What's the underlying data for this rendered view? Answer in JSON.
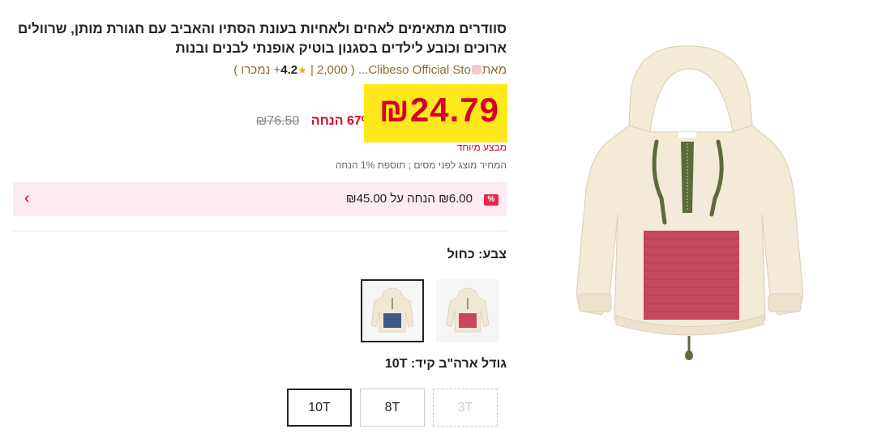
{
  "product": {
    "title": "סוודרים מתאימים לאחים ולאחיות בעונת הסתיו והאביב עם חגורת מותן, שרוולים ארוכים וכובע לילדים בסגנון בוטיק אופנתי לבנים ובנות",
    "by_label": "מאת",
    "store_name": "Clibeso Official Sto...",
    "rating": "4.2",
    "sold_count": "2,000+",
    "sold_label": "נמכרו",
    "open_paren": "(",
    "close_paren": ")",
    "separator": "|"
  },
  "pricing": {
    "current_price": "₪24.79",
    "discount_percent": "67%",
    "discount_word": "הנחה",
    "original_price": "₪76.50",
    "special_offer": "מבצע מיוחד",
    "tax_note": "המחיר מוצג לפני מסים ; תוספת 1% הנחה"
  },
  "coupon": {
    "badge": "%",
    "text": "₪6.00 הנחה על ₪45.00",
    "arrow": "›"
  },
  "color": {
    "label": "צבע: כחול",
    "options": [
      {
        "name": "blue",
        "selected": true,
        "pocket_color": "#3e5a8a"
      },
      {
        "name": "red",
        "selected": false,
        "pocket_color": "#c5485e"
      }
    ]
  },
  "size": {
    "label": "גודל ארה\"ב קיד: 10T",
    "options": [
      {
        "label": "10T",
        "state": "selected"
      },
      {
        "label": "8T",
        "state": "available"
      },
      {
        "label": "3T",
        "state": "disabled"
      }
    ]
  },
  "colors": {
    "accent_red": "#d4002a",
    "price_highlight": "#ffe81a",
    "coupon_bg": "#fdecef",
    "hoodie_cream": "#f3ead7",
    "pocket_red": "#c5485e"
  }
}
